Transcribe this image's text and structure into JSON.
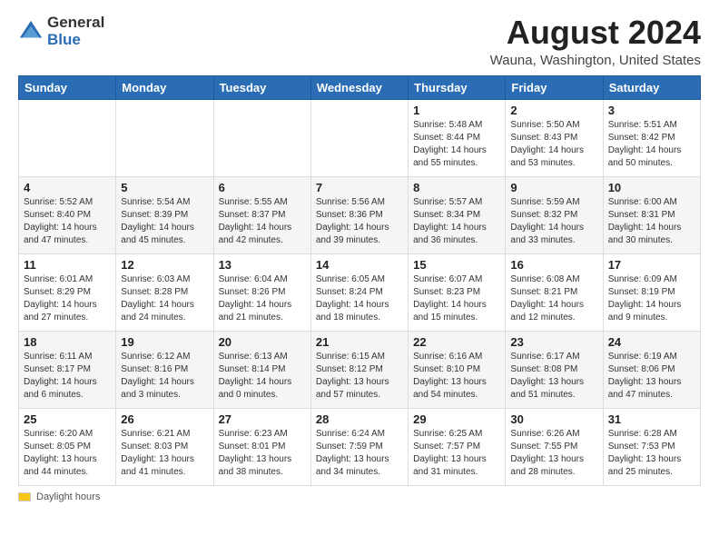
{
  "header": {
    "logo_general": "General",
    "logo_blue": "Blue",
    "main_title": "August 2024",
    "subtitle": "Wauna, Washington, United States"
  },
  "calendar": {
    "days_of_week": [
      "Sunday",
      "Monday",
      "Tuesday",
      "Wednesday",
      "Thursday",
      "Friday",
      "Saturday"
    ],
    "weeks": [
      [
        {
          "day": "",
          "info": ""
        },
        {
          "day": "",
          "info": ""
        },
        {
          "day": "",
          "info": ""
        },
        {
          "day": "",
          "info": ""
        },
        {
          "day": "1",
          "info": "Sunrise: 5:48 AM\nSunset: 8:44 PM\nDaylight: 14 hours\nand 55 minutes."
        },
        {
          "day": "2",
          "info": "Sunrise: 5:50 AM\nSunset: 8:43 PM\nDaylight: 14 hours\nand 53 minutes."
        },
        {
          "day": "3",
          "info": "Sunrise: 5:51 AM\nSunset: 8:42 PM\nDaylight: 14 hours\nand 50 minutes."
        }
      ],
      [
        {
          "day": "4",
          "info": "Sunrise: 5:52 AM\nSunset: 8:40 PM\nDaylight: 14 hours\nand 47 minutes."
        },
        {
          "day": "5",
          "info": "Sunrise: 5:54 AM\nSunset: 8:39 PM\nDaylight: 14 hours\nand 45 minutes."
        },
        {
          "day": "6",
          "info": "Sunrise: 5:55 AM\nSunset: 8:37 PM\nDaylight: 14 hours\nand 42 minutes."
        },
        {
          "day": "7",
          "info": "Sunrise: 5:56 AM\nSunset: 8:36 PM\nDaylight: 14 hours\nand 39 minutes."
        },
        {
          "day": "8",
          "info": "Sunrise: 5:57 AM\nSunset: 8:34 PM\nDaylight: 14 hours\nand 36 minutes."
        },
        {
          "day": "9",
          "info": "Sunrise: 5:59 AM\nSunset: 8:32 PM\nDaylight: 14 hours\nand 33 minutes."
        },
        {
          "day": "10",
          "info": "Sunrise: 6:00 AM\nSunset: 8:31 PM\nDaylight: 14 hours\nand 30 minutes."
        }
      ],
      [
        {
          "day": "11",
          "info": "Sunrise: 6:01 AM\nSunset: 8:29 PM\nDaylight: 14 hours\nand 27 minutes."
        },
        {
          "day": "12",
          "info": "Sunrise: 6:03 AM\nSunset: 8:28 PM\nDaylight: 14 hours\nand 24 minutes."
        },
        {
          "day": "13",
          "info": "Sunrise: 6:04 AM\nSunset: 8:26 PM\nDaylight: 14 hours\nand 21 minutes."
        },
        {
          "day": "14",
          "info": "Sunrise: 6:05 AM\nSunset: 8:24 PM\nDaylight: 14 hours\nand 18 minutes."
        },
        {
          "day": "15",
          "info": "Sunrise: 6:07 AM\nSunset: 8:23 PM\nDaylight: 14 hours\nand 15 minutes."
        },
        {
          "day": "16",
          "info": "Sunrise: 6:08 AM\nSunset: 8:21 PM\nDaylight: 14 hours\nand 12 minutes."
        },
        {
          "day": "17",
          "info": "Sunrise: 6:09 AM\nSunset: 8:19 PM\nDaylight: 14 hours\nand 9 minutes."
        }
      ],
      [
        {
          "day": "18",
          "info": "Sunrise: 6:11 AM\nSunset: 8:17 PM\nDaylight: 14 hours\nand 6 minutes."
        },
        {
          "day": "19",
          "info": "Sunrise: 6:12 AM\nSunset: 8:16 PM\nDaylight: 14 hours\nand 3 minutes."
        },
        {
          "day": "20",
          "info": "Sunrise: 6:13 AM\nSunset: 8:14 PM\nDaylight: 14 hours\nand 0 minutes."
        },
        {
          "day": "21",
          "info": "Sunrise: 6:15 AM\nSunset: 8:12 PM\nDaylight: 13 hours\nand 57 minutes."
        },
        {
          "day": "22",
          "info": "Sunrise: 6:16 AM\nSunset: 8:10 PM\nDaylight: 13 hours\nand 54 minutes."
        },
        {
          "day": "23",
          "info": "Sunrise: 6:17 AM\nSunset: 8:08 PM\nDaylight: 13 hours\nand 51 minutes."
        },
        {
          "day": "24",
          "info": "Sunrise: 6:19 AM\nSunset: 8:06 PM\nDaylight: 13 hours\nand 47 minutes."
        }
      ],
      [
        {
          "day": "25",
          "info": "Sunrise: 6:20 AM\nSunset: 8:05 PM\nDaylight: 13 hours\nand 44 minutes."
        },
        {
          "day": "26",
          "info": "Sunrise: 6:21 AM\nSunset: 8:03 PM\nDaylight: 13 hours\nand 41 minutes."
        },
        {
          "day": "27",
          "info": "Sunrise: 6:23 AM\nSunset: 8:01 PM\nDaylight: 13 hours\nand 38 minutes."
        },
        {
          "day": "28",
          "info": "Sunrise: 6:24 AM\nSunset: 7:59 PM\nDaylight: 13 hours\nand 34 minutes."
        },
        {
          "day": "29",
          "info": "Sunrise: 6:25 AM\nSunset: 7:57 PM\nDaylight: 13 hours\nand 31 minutes."
        },
        {
          "day": "30",
          "info": "Sunrise: 6:26 AM\nSunset: 7:55 PM\nDaylight: 13 hours\nand 28 minutes."
        },
        {
          "day": "31",
          "info": "Sunrise: 6:28 AM\nSunset: 7:53 PM\nDaylight: 13 hours\nand 25 minutes."
        }
      ]
    ]
  },
  "footer": {
    "label": "Daylight hours"
  }
}
